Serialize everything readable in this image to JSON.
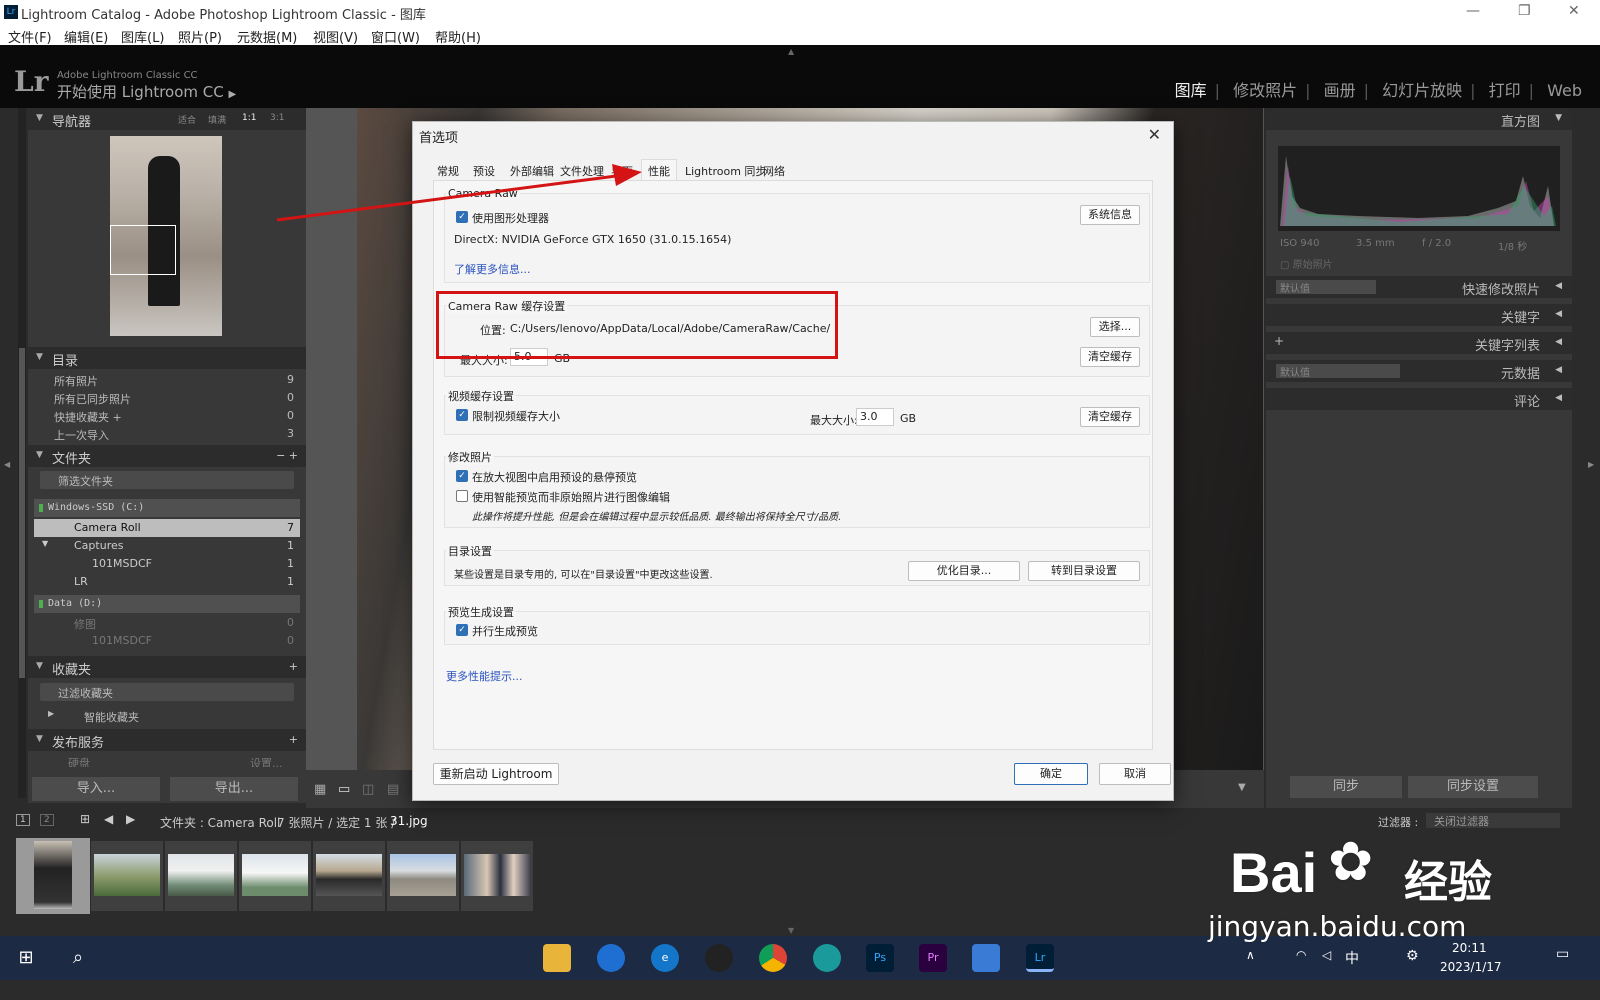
{
  "window": {
    "title": "Lightroom Catalog - Adobe Photoshop Lightroom Classic - 图库",
    "icon": "Lr"
  },
  "menu": [
    "文件(F)",
    "编辑(E)",
    "图库(L)",
    "照片(P)",
    "元数据(M)",
    "视图(V)",
    "窗口(W)",
    "帮助(H)"
  ],
  "identity": {
    "logo": "Lr",
    "product": "Adobe Lightroom Classic CC",
    "tagline": "开始使用 Lightroom CC",
    "play": "▶"
  },
  "modules": [
    "图库",
    "修改照片",
    "画册",
    "幻灯片放映",
    "打印",
    "Web"
  ],
  "navigator": {
    "title": "导航器",
    "zoom": [
      "适合",
      "填满",
      "1:1",
      "3:1"
    ]
  },
  "catalog": {
    "title": "目录",
    "items": [
      {
        "label": "所有照片",
        "count": "9"
      },
      {
        "label": "所有已同步照片",
        "count": "0"
      },
      {
        "label": "快捷收藏夹 +",
        "count": "0"
      },
      {
        "label": "上一次导入",
        "count": "3"
      }
    ]
  },
  "folders": {
    "title": "文件夹",
    "actions": "−  +",
    "filter_placeholder": "筛选文件夹",
    "drive_c": "Windows-SSD (C:)",
    "drive_d": "Data (D:)",
    "items": [
      {
        "label": "Camera Roll",
        "count": "7"
      },
      {
        "label": "Captures",
        "count": "1"
      },
      {
        "label": "101MSDCF",
        "count": "1"
      },
      {
        "label": "LR",
        "count": "1"
      }
    ],
    "d_items": [
      {
        "label": "修图",
        "count": "0"
      },
      {
        "label": "101MSDCF",
        "count": "0"
      }
    ]
  },
  "collections": {
    "title": "收藏夹",
    "filter": "过滤收藏夹",
    "smart": "智能收藏夹"
  },
  "publish": {
    "title": "发布服务",
    "item": "硬盘",
    "setup": "设置..."
  },
  "left_buttons": {
    "import": "导入...",
    "export": "导出..."
  },
  "right": {
    "histogram": "直方图",
    "exif": [
      "ISO 940",
      "3.5 mm",
      "f / 2.0",
      "1/8 秒"
    ],
    "original": "原始照片",
    "quick_develop": "快速修改照片",
    "preset_default": "默认值",
    "keywords": "关键字",
    "keyword_list": "关键字列表",
    "metadata": "元数据",
    "comments": "评论",
    "sync": "同步",
    "sync_settings": "同步设置"
  },
  "filmstrip": {
    "pages": [
      "1",
      "2"
    ],
    "path": "文件夹 : Camera Roll",
    "info": "7 张照片 / 选定 1 张 /",
    "file": "31.jpg",
    "filter_label": "过滤器 :",
    "filter_value": "关闭过滤器"
  },
  "dialog": {
    "title": "首选项",
    "tabs": [
      "常规",
      "预设",
      "外部编辑",
      "文件处理",
      "界面",
      "性能",
      "Lightroom 同步",
      "网络"
    ],
    "camera_raw": {
      "title": "Camera Raw",
      "use_gpu": "使用图形处理器",
      "gpu": "DirectX: NVIDIA GeForce GTX 1650 (31.0.15.1654)",
      "learn": "了解更多信息...",
      "sysinfo": "系统信息"
    },
    "cache": {
      "title": "Camera Raw 缓存设置",
      "location_label": "位置:",
      "location": "C:/Users/lenovo/AppData/Local/Adobe/CameraRaw/Cache/",
      "choose": "选择...",
      "max_label": "最大大小:",
      "max": "5.0",
      "unit": "GB",
      "purge": "清空缓存"
    },
    "video": {
      "title": "视频缓存设置",
      "limit": "限制视频缓存大小",
      "max_label": "最大大小:",
      "max": "3.0",
      "unit": "GB",
      "purge": "清空缓存"
    },
    "develop": {
      "title": "修改照片",
      "hover": "在放大视图中启用预设的悬停预览",
      "smart": "使用智能预览而非原始照片进行图像编辑",
      "note": "此操作将提升性能, 但是会在编辑过程中显示较低品质. 最终输出将保持全尺寸/品质."
    },
    "catalog": {
      "title": "目录设置",
      "desc": "某些设置是目录专用的, 可以在\"目录设置\"中更改这些设置.",
      "optimize": "优化目录...",
      "goto": "转到目录设置"
    },
    "preview": {
      "title": "预览生成设置",
      "parallel": "并行生成预览"
    },
    "more": "更多性能提示...",
    "restart": "重新启动 Lightroom",
    "ok": "确定",
    "cancel": "取消"
  },
  "taskbar": {
    "time": "20:11",
    "date": "2023/1/17",
    "ime": "中"
  },
  "watermark": {
    "brand": "Bai",
    "du": "经验",
    "url": "jingyan.baidu.com"
  },
  "colors": {
    "callout": "#d41414",
    "accent": "#2f6fb5"
  }
}
